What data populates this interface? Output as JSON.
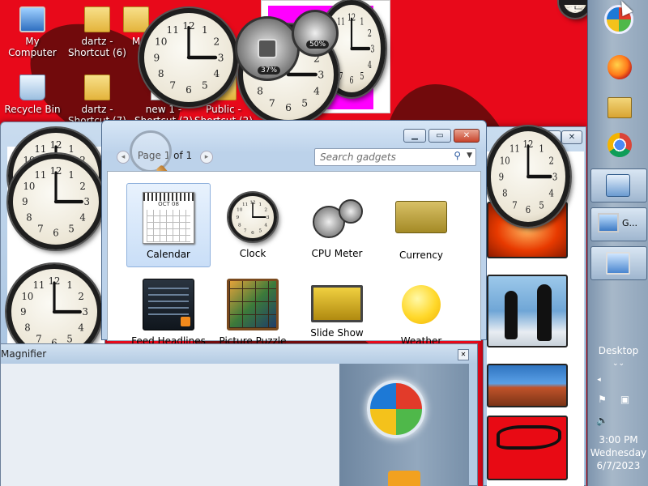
{
  "desktop": {
    "icons": [
      {
        "label": "My Computer",
        "icon": "computer-icon"
      },
      {
        "label": "dartz - Shortcut (6)",
        "icon": "folder-shortcut-icon"
      },
      {
        "label": "M",
        "icon": "folder-icon"
      },
      {
        "label": "Recycle Bin",
        "icon": "recycle-bin-icon"
      },
      {
        "label": "dartz - Shortcut (7)",
        "icon": "folder-shortcut-icon"
      },
      {
        "label": "new 1 - Shortcut (2)",
        "icon": "file-shortcut-icon"
      },
      {
        "label": "Public - Shortcut (2)",
        "icon": "folder-shortcut-icon"
      }
    ]
  },
  "cpu_meter": {
    "cpu": "37%",
    "memory": "50%"
  },
  "gadget_gallery": {
    "page_label": "Page 1 of 1",
    "search_placeholder": "Search gadgets",
    "title_buttons": {
      "minimize": "▁",
      "restore": "▭",
      "close": "✕"
    },
    "gadgets": [
      {
        "label": "Calendar",
        "icon": "calendar-icon",
        "selected": true,
        "month": "OCT 08"
      },
      {
        "label": "Clock",
        "icon": "clock-icon",
        "selected": false
      },
      {
        "label": "CPU Meter",
        "icon": "cpu-meter-icon",
        "selected": false
      },
      {
        "label": "Currency",
        "icon": "currency-icon",
        "selected": false
      },
      {
        "label": "Feed Headlines",
        "icon": "feed-headlines-icon",
        "selected": false
      },
      {
        "label": "Picture Puzzle",
        "icon": "picture-puzzle-icon",
        "selected": false
      },
      {
        "label": "Slide Show",
        "icon": "slide-show-icon",
        "selected": false
      },
      {
        "label": "Weather",
        "icon": "weather-icon",
        "selected": false
      }
    ]
  },
  "magnifier": {
    "title": "Magnifier",
    "close": "✕"
  },
  "taskbar": {
    "show_desktop_label": "Desktop",
    "tray_time": "3:00 PM",
    "tray_day": "Wednesday",
    "tray_date": "6/7/2023",
    "button_label": "G...",
    "items": [
      "start-orb-icon",
      "firefox-icon",
      "file-explorer-icon",
      "chrome-icon",
      "gadgets-icon",
      "remote-desktop-icon",
      "network-icon"
    ]
  },
  "colors": {
    "desktop": "#e8091a",
    "selection": "#c9def7"
  }
}
